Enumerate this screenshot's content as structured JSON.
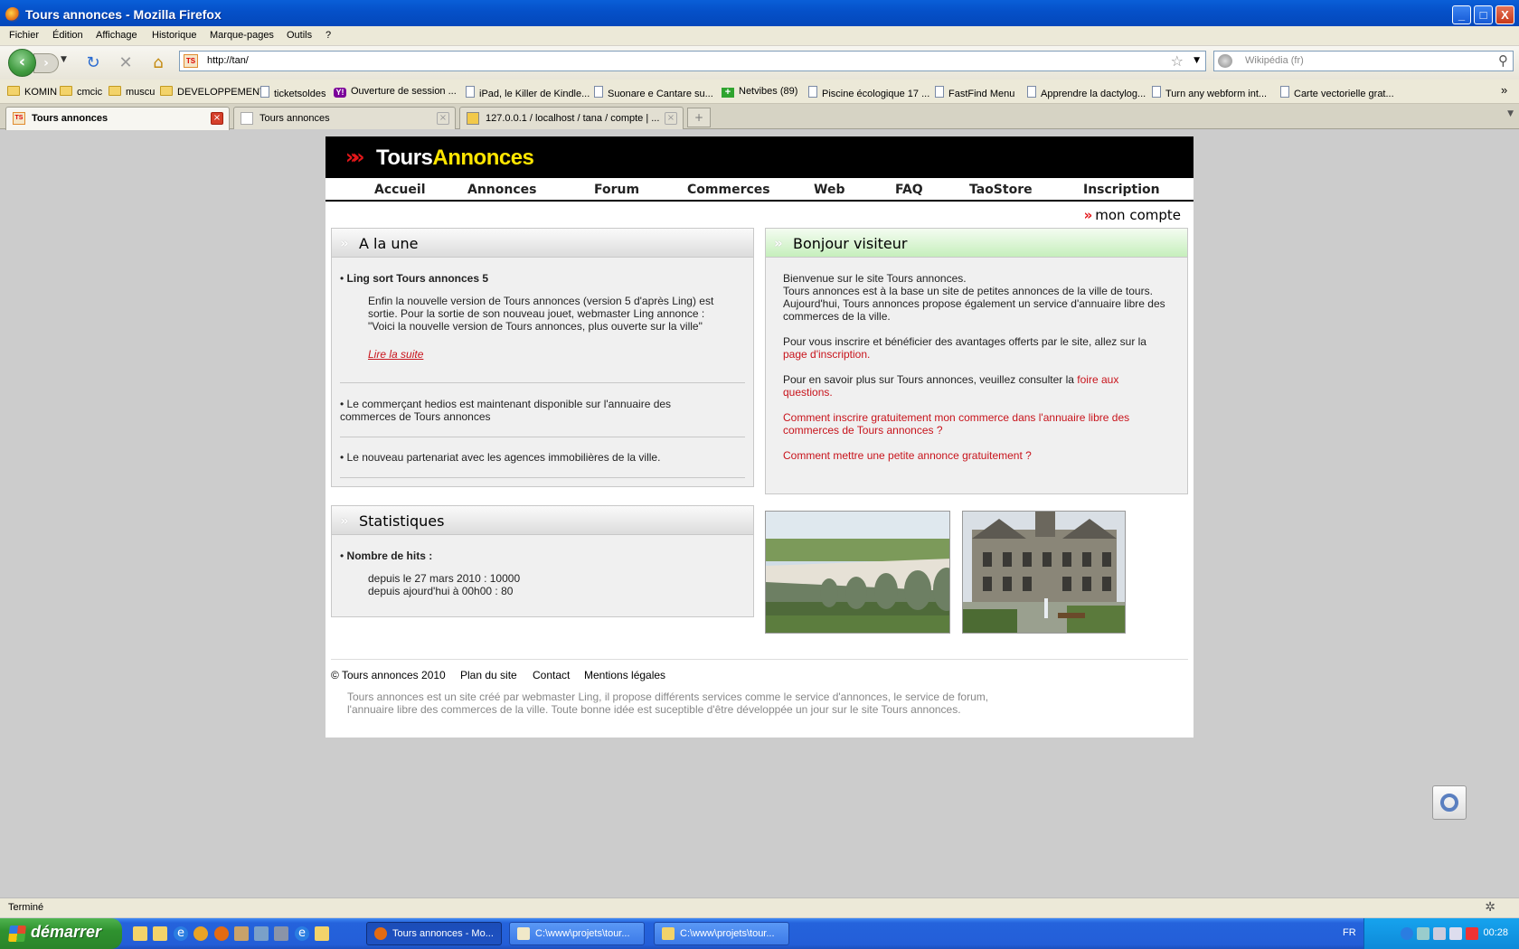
{
  "window": {
    "title": "Tours annonces - Mozilla Firefox",
    "buttons": {
      "minimize": "_",
      "maximize": "□",
      "close": "X"
    }
  },
  "menu": [
    "Fichier",
    "Édition",
    "Affichage",
    "Historique",
    "Marque-pages",
    "Outils",
    "?"
  ],
  "navbar": {
    "url": "http://tan/",
    "search_placeholder": "Wikipédia (fr)",
    "icons": [
      "back-icon",
      "forward-icon",
      "reload-icon",
      "stop-icon",
      "home-icon",
      "star-icon",
      "search-icon"
    ]
  },
  "bookmarks": [
    {
      "label": "KOMIN",
      "icon": "folder"
    },
    {
      "label": "cmcic",
      "icon": "folder"
    },
    {
      "label": "muscu",
      "icon": "folder"
    },
    {
      "label": "DEVELOPPEMENT",
      "icon": "folder"
    },
    {
      "label": "ticketsoldes",
      "icon": "page"
    },
    {
      "label": "Ouverture de session ...",
      "icon": "yahoo"
    },
    {
      "label": "iPad, le Killer de Kindle...",
      "icon": "page"
    },
    {
      "label": "Suonare e Cantare su...",
      "icon": "page"
    },
    {
      "label": "Netvibes (89)",
      "icon": "plus"
    },
    {
      "label": "Piscine écologique 17 ...",
      "icon": "page"
    },
    {
      "label": "FastFind Menu",
      "icon": "page"
    },
    {
      "label": "Apprendre la dactylog...",
      "icon": "page"
    },
    {
      "label": "Turn any webform int...",
      "icon": "page"
    },
    {
      "label": "Carte vectorielle grat...",
      "icon": "page"
    }
  ],
  "bookmarks_more": "»",
  "tabs": [
    {
      "label": "Tours annonces",
      "active": true
    },
    {
      "label": "Tours annonces",
      "active": false
    },
    {
      "label": "127.0.0.1 / localhost / tana / compte | ...",
      "active": false
    }
  ],
  "newtab": "+",
  "site": {
    "logo": {
      "part1": "Tours",
      "part2": "Annonces",
      "chevrons": "»»"
    },
    "nav": [
      "Accueil",
      "Annonces",
      "Forum",
      "Commerces",
      "Web",
      "FAQ",
      "TaoStore",
      "Inscription"
    ],
    "mon_compte": "mon compte",
    "une": {
      "title": "A la une",
      "item1_title": "Ling sort Tours annonces 5",
      "item1_body": "Enfin la nouvelle version de Tours annonces (version 5 d'après Ling) est sortie. Pour la sortie de son nouveau jouet, webmaster Ling annonce : \"Voici la nouvelle version de Tours annonces, plus ouverte sur la ville\"",
      "item1_link": "Lire la suite",
      "item2": "Le commerçant hedios est maintenant disponible sur l'annuaire des commerces de Tours annonces",
      "item3": "Le nouveau partenariat avec les agences immobilières de la ville."
    },
    "bonjour": {
      "title": "Bonjour visiteur",
      "p1": "Bienvenue sur le site Tours annonces.",
      "p1b": "Tours annonces est à la base un site de petites annonces de la ville de tours. Aujourd'hui, Tours annonces propose également un service d'annuaire libre des commerces de la ville.",
      "p2": "Pour vous inscrire et bénéficier des avantages offerts par le site, allez sur la",
      "p2_link": "page d'inscription.",
      "p3": "Pour en savoir plus sur Tours annonces, veuillez consulter la",
      "p3_link": "foire aux questions.",
      "link1": "Comment inscrire gratuitement mon commerce dans l'annuaire libre des commerces de Tours annonces ?",
      "link2": "Comment mettre une petite annonce gratuitement ?"
    },
    "stats": {
      "title": "Statistiques",
      "label": "Nombre de hits :",
      "line1": "depuis le 27 mars 2010 : 10000",
      "line2": "depuis ajourd'hui à 00h00 : 80"
    },
    "footer": {
      "copyright": "© Tours annonces 2010",
      "links": [
        "Plan du site",
        "Contact",
        "Mentions légales"
      ],
      "description": "Tours annonces est un site créé par webmaster Ling, il propose différents services comme le service d'annonces, le service de forum, l'annuaire libre des commerces de la ville. Toute bonne idée est suceptible d'être développée un jour sur le site Tours annonces."
    }
  },
  "status": "Terminé",
  "taskbar": {
    "start": "démarrer",
    "tasks": [
      {
        "label": "Tours annonces - Mo...",
        "active": true
      },
      {
        "label": "C:\\www\\projets\\tour...",
        "active": false
      },
      {
        "label": "C:\\www\\projets\\tour...",
        "active": false
      }
    ],
    "lang": "FR",
    "clock": "00:28"
  },
  "colors": {
    "accent_red": "#c8141c",
    "logo_yellow": "#ffe600",
    "xp_blue": "#0550c8"
  }
}
